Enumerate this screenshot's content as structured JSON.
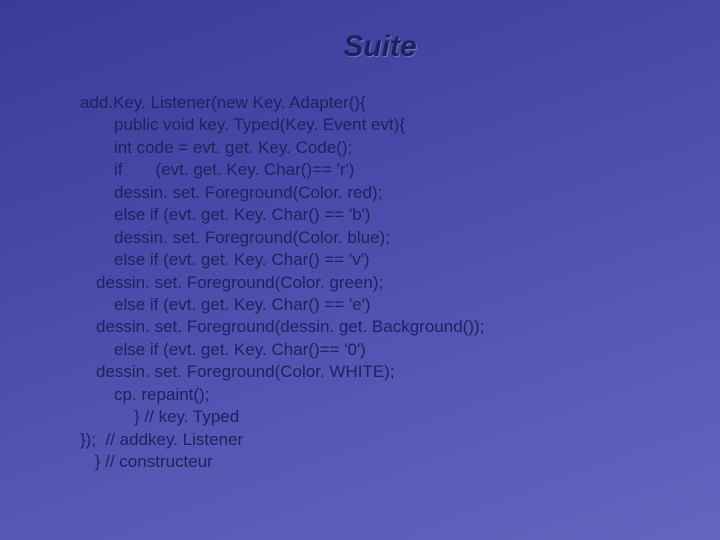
{
  "title": "Suite",
  "code": {
    "l00": "add.Key. Listener(new Key. Adapter(){",
    "l01": "public void key. Typed(Key. Event evt){",
    "l02": "int code = evt. get. Key. Code();",
    "l03": "if       (evt. get. Key. Char()== 'r')",
    "l04": "dessin. set. Foreground(Color. red);",
    "l05": "else if (evt. get. Key. Char() == 'b')",
    "l06": "dessin. set. Foreground(Color. blue);",
    "l07": "else if (evt. get. Key. Char() == 'v')",
    "l08": "dessin. set. Foreground(Color. green);",
    "l09": "else if (evt. get. Key. Char() == 'e')",
    "l10": "dessin. set. Foreground(dessin. get. Background());",
    "l11": "else if (evt. get. Key. Char()== '0')",
    "l12": "dessin. set. Foreground(Color. WHITE);",
    "l13": "cp. repaint();",
    "l14": "} // key. Typed",
    "l15": "});  // addkey. Listener",
    "l16": " } // constructeur"
  }
}
